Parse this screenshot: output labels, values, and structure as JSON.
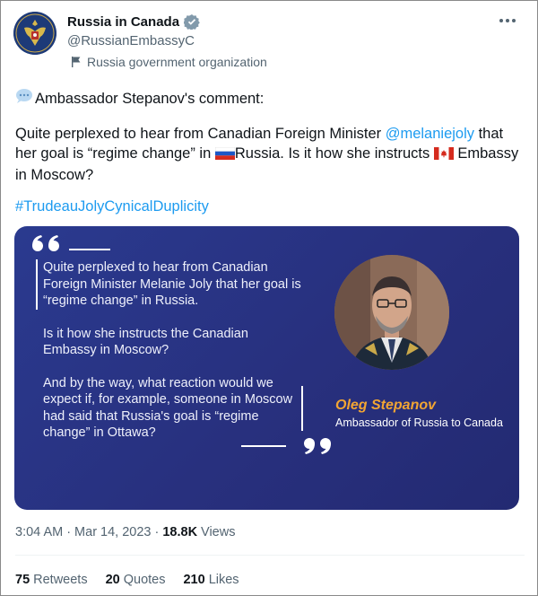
{
  "account": {
    "display_name": "Russia in Canada",
    "handle": "@RussianEmbassyC",
    "label": "Russia government organization"
  },
  "tweet": {
    "intro": "Ambassador Stepanov's comment:",
    "line_a": "Quite perplexed to hear from Canadian Foreign Minister ",
    "mention": "@melaniejoly",
    "line_b": " that her goal is “regime change” in ",
    "line_c": "Russia. Is it how she instructs ",
    "line_d": " Embassy in Moscow?",
    "hashtag": "#TrudeauJolyCynicalDuplicity"
  },
  "card": {
    "para1": "Quite perplexed to hear from Canadian Foreign Minister Melanie Joly that her goal is “regime change” in Russia.",
    "para2": "Is it how she instructs the Canadian Embassy in Moscow?",
    "para3": "And by the way, what reaction would we expect if, for example, someone in Moscow had said that Russia's goal is “regime change” in Ottawa?",
    "speaker_name": "Oleg Stepanov",
    "speaker_title": "Ambassador of Russia to Canada"
  },
  "meta": {
    "time": "3:04 AM",
    "sep1": "·",
    "date": "Mar 14, 2023",
    "sep2": "·",
    "views_count": "18.8K",
    "views_label": "Views"
  },
  "stats": {
    "retweets_count": "75",
    "retweets_label": "Retweets",
    "quotes_count": "20",
    "quotes_label": "Quotes",
    "likes_count": "210",
    "likes_label": "Likes"
  },
  "colors": {
    "link": "#1d9bf0",
    "card_bg": "#2a3a8f",
    "accent_name": "#f2a533",
    "muted": "#536471"
  },
  "icons": [
    "coat-of-arms-avatar",
    "verified-badge-icon",
    "government-flag-icon",
    "more-options-icon",
    "speech-bubble-icon",
    "russia-flag-icon",
    "canada-flag-icon",
    "open-quote-icon",
    "close-quote-icon"
  ]
}
